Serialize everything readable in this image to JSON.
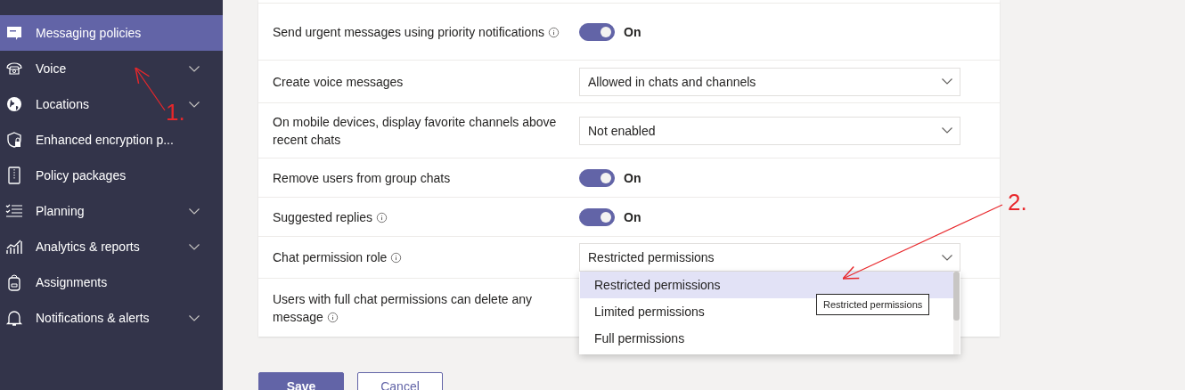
{
  "sidebar": {
    "items": [
      {
        "label": "Messaging policies",
        "expandable": false,
        "selected": true
      },
      {
        "label": "Voice",
        "expandable": true,
        "selected": false
      },
      {
        "label": "Locations",
        "expandable": true,
        "selected": false
      },
      {
        "label": "Enhanced encryption p...",
        "expandable": false,
        "selected": false
      },
      {
        "label": "Policy packages",
        "expandable": false,
        "selected": false
      },
      {
        "label": "Planning",
        "expandable": true,
        "selected": false
      },
      {
        "label": "Analytics & reports",
        "expandable": true,
        "selected": false
      },
      {
        "label": "Assignments",
        "expandable": false,
        "selected": false
      },
      {
        "label": "Notifications & alerts",
        "expandable": true,
        "selected": false
      }
    ]
  },
  "settings": [
    {
      "label": "Send urgent messages using priority notifications",
      "info": true,
      "kind": "toggle",
      "on": true,
      "value": "On"
    },
    {
      "label": "Create voice messages",
      "info": false,
      "kind": "dropdown",
      "value": "Allowed in chats and channels"
    },
    {
      "label": "On mobile devices, display favorite channels above recent chats",
      "info": false,
      "kind": "dropdown",
      "value": "Not enabled"
    },
    {
      "label": "Remove users from group chats",
      "info": false,
      "kind": "toggle",
      "on": true,
      "value": "On"
    },
    {
      "label": "Suggested replies",
      "info": true,
      "kind": "toggle",
      "on": true,
      "value": "On"
    },
    {
      "label": "Chat permission role",
      "info": true,
      "kind": "dropdown",
      "value": "Restricted permissions",
      "open": true,
      "options": [
        {
          "label": "Restricted permissions",
          "selected": true
        },
        {
          "label": "Limited permissions",
          "selected": false
        },
        {
          "label": "Full permissions",
          "selected": false
        }
      ],
      "tooltip": "Restricted permissions"
    },
    {
      "label": "Users with full chat permissions can delete any message",
      "info": true,
      "kind": "none"
    }
  ],
  "buttons": [
    {
      "label": "Save",
      "primary": true
    },
    {
      "label": "Cancel",
      "primary": false
    }
  ],
  "annotations": [
    {
      "label": "1."
    },
    {
      "label": "2."
    }
  ]
}
